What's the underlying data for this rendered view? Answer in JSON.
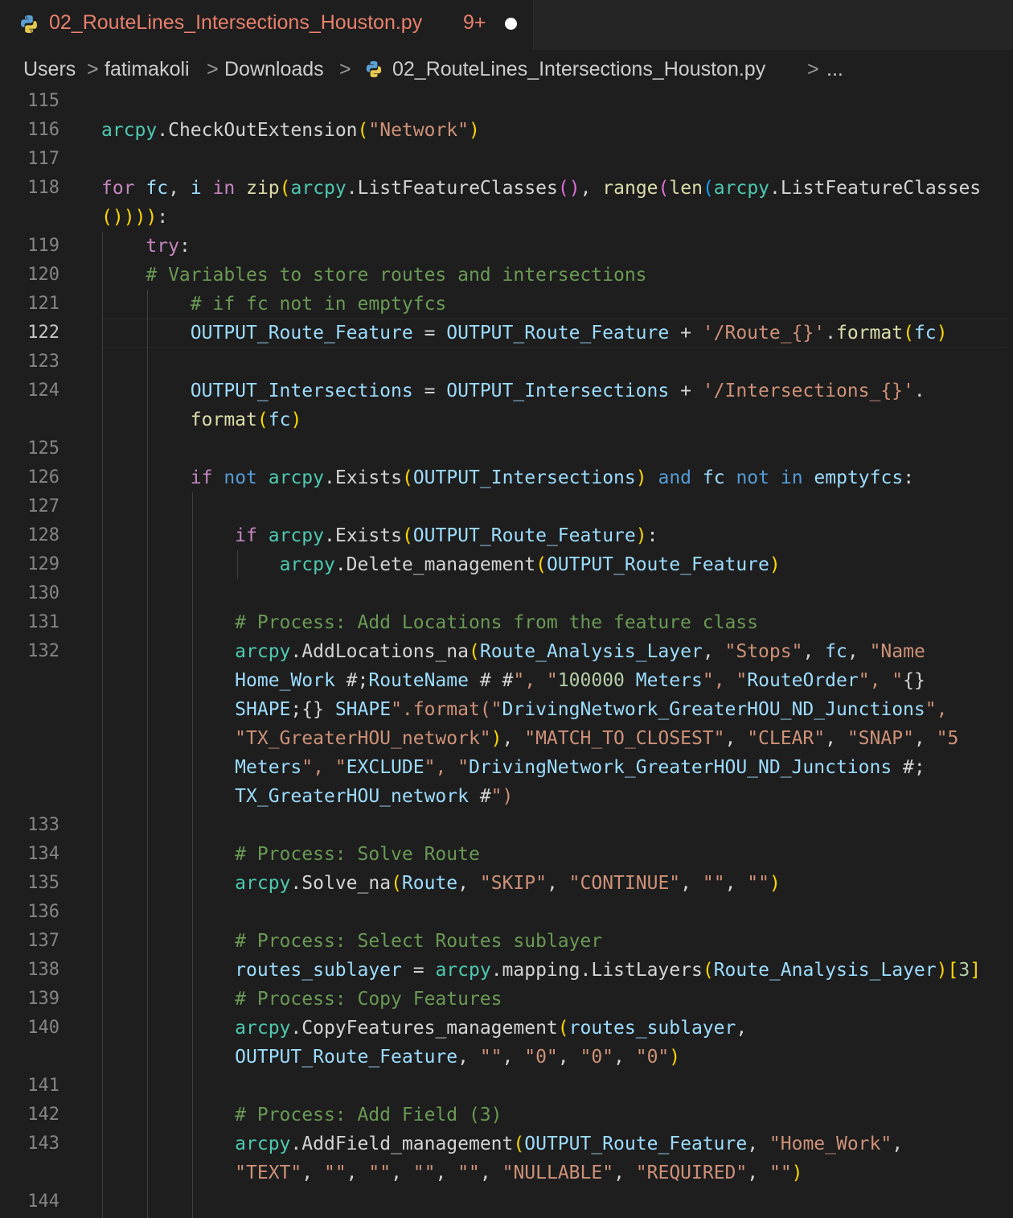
{
  "tab": {
    "filename": "02_RouteLines_Intersections_Houston.py",
    "badge": "9+",
    "language_icon": "python-icon",
    "modified": true
  },
  "breadcrumb": {
    "items": [
      "Users",
      "fatimakoli",
      "Downloads",
      "02_RouteLines_Intersections_Houston.py",
      "..."
    ],
    "separator": ">"
  },
  "editor": {
    "active_line": "122",
    "lines": [
      {
        "n": "115",
        "text": ""
      },
      {
        "n": "116",
        "text": "arcpy.CheckOutExtension(\"Network\")"
      },
      {
        "n": "117",
        "text": ""
      },
      {
        "n": "118",
        "text": "for fc, i in zip(arcpy.ListFeatureClasses(), range(len(arcpy.ListFeatureClasses\n()))):"
      },
      {
        "n": "119",
        "text": "    try:"
      },
      {
        "n": "120",
        "text": "    # Variables to store routes and intersections"
      },
      {
        "n": "121",
        "text": "        # if fc not in emptyfcs"
      },
      {
        "n": "122",
        "text": "        OUTPUT_Route_Feature = OUTPUT_Route_Feature + '/Route_{}'.format(fc)"
      },
      {
        "n": "123",
        "text": ""
      },
      {
        "n": "124",
        "text": "        OUTPUT_Intersections = OUTPUT_Intersections + '/Intersections_{}'.\nformat(fc)"
      },
      {
        "n": "125",
        "text": ""
      },
      {
        "n": "126",
        "text": "        if not arcpy.Exists(OUTPUT_Intersections) and fc not in emptyfcs:"
      },
      {
        "n": "127",
        "text": ""
      },
      {
        "n": "128",
        "text": "            if arcpy.Exists(OUTPUT_Route_Feature):"
      },
      {
        "n": "129",
        "text": "                arcpy.Delete_management(OUTPUT_Route_Feature)"
      },
      {
        "n": "130",
        "text": ""
      },
      {
        "n": "131",
        "text": "            # Process: Add Locations from the feature class"
      },
      {
        "n": "132",
        "text": "            arcpy.AddLocations_na(Route_Analysis_Layer, \"Stops\", fc, \"Name\nHome_Work #;RouteName # #\", \"100000 Meters\", \"RouteOrder\", \"{}\nSHAPE;{} SHAPE\".format(\"DrivingNetwork_GreaterHOU_ND_Junctions\",\n\"TX_GreaterHOU_network\"), \"MATCH_TO_CLOSEST\", \"CLEAR\", \"SNAP\", \"5\nMeters\", \"EXCLUDE\", \"DrivingNetwork_GreaterHOU_ND_Junctions #;\nTX_GreaterHOU_network #\")"
      },
      {
        "n": "133",
        "text": ""
      },
      {
        "n": "134",
        "text": "            # Process: Solve Route"
      },
      {
        "n": "135",
        "text": "            arcpy.Solve_na(Route, \"SKIP\", \"CONTINUE\", \"\", \"\")"
      },
      {
        "n": "136",
        "text": ""
      },
      {
        "n": "137",
        "text": "            # Process: Select Routes sublayer"
      },
      {
        "n": "138",
        "text": "            routes_sublayer = arcpy.mapping.ListLayers(Route_Analysis_Layer)[3]"
      },
      {
        "n": "139",
        "text": "            # Process: Copy Features"
      },
      {
        "n": "140",
        "text": "            arcpy.CopyFeatures_management(routes_sublayer,\nOUTPUT_Route_Feature, \"\", \"0\", \"0\", \"0\")"
      },
      {
        "n": "141",
        "text": ""
      },
      {
        "n": "142",
        "text": "            # Process: Add Field (3)"
      },
      {
        "n": "143",
        "text": "            arcpy.AddField_management(OUTPUT_Route_Feature, \"Home_Work\",\n\"TEXT\", \"\", \"\", \"\", \"\", \"NULLABLE\", \"REQUIRED\", \"\")"
      },
      {
        "n": "144",
        "text": ""
      }
    ]
  }
}
